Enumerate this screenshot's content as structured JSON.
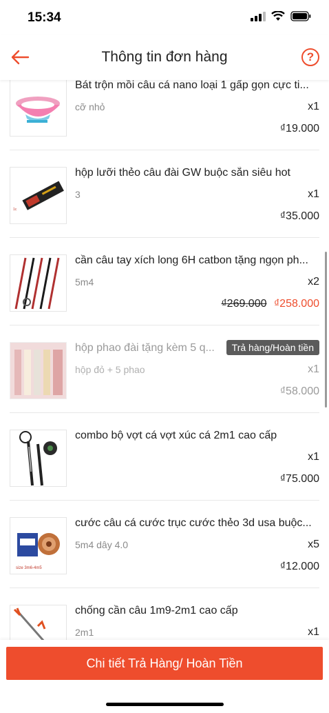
{
  "status": {
    "time": "15:34"
  },
  "header": {
    "title": "Thông tin đơn hàng",
    "back_icon": "back-arrow-icon",
    "help_icon": "help-icon",
    "help_label": "?"
  },
  "accent_color": "#ee4d2d",
  "items": [
    {
      "name": "Bát trộn mồi câu cá nano loại 1 gấp gọn cực ti...",
      "variant": "cỡ nhỏ",
      "qty": "x1",
      "price": "₫19.000",
      "original_price": "",
      "badge": ""
    },
    {
      "name": "hộp lưỡi thẻo câu đài GW buộc sẵn siêu hot",
      "variant": "3",
      "qty": "x1",
      "price": "₫35.000",
      "original_price": "",
      "badge": ""
    },
    {
      "name": "cần câu tay xích long 6H catbon tặng ngọn ph...",
      "variant": "5m4",
      "qty": "x2",
      "price": "₫258.000",
      "original_price": "₫269.000",
      "badge": ""
    },
    {
      "name": "hộp phao đài tặng kèm 5 q...",
      "variant": "hộp đỏ + 5 phao",
      "qty": "x1",
      "price": "₫58.000",
      "original_price": "",
      "badge": "Trả hàng/Hoàn tiền"
    },
    {
      "name": "combo bộ vợt cá vợt xúc cá 2m1 cao cấp",
      "variant": "",
      "qty": "x1",
      "price": "₫75.000",
      "original_price": "",
      "badge": ""
    },
    {
      "name": "cước câu cá cước trục cước thẻo 3d usa buộc...",
      "variant": "5m4 dây 4.0",
      "qty": "x5",
      "price": "₫12.000",
      "original_price": "",
      "badge": ""
    },
    {
      "name": "chống cần câu 1m9-2m1 cao cấp",
      "variant": "2m1",
      "qty": "x1",
      "price": "",
      "original_price": "",
      "badge": ""
    }
  ],
  "footer": {
    "button_label": "Chi tiết Trả Hàng/ Hoàn Tiền"
  }
}
